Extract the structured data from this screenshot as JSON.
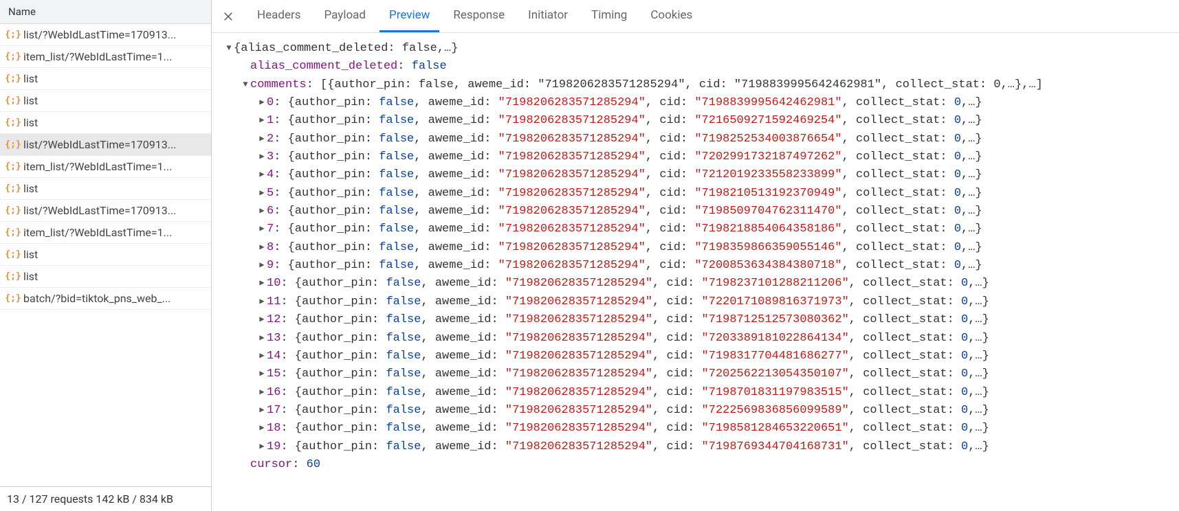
{
  "sidebar": {
    "header": "Name",
    "items": [
      {
        "label": "list/?WebIdLastTime=170913...",
        "selected": false
      },
      {
        "label": "item_list/?WebIdLastTime=1...",
        "selected": false
      },
      {
        "label": "list",
        "selected": false
      },
      {
        "label": "list",
        "selected": false
      },
      {
        "label": "list",
        "selected": false
      },
      {
        "label": "list/?WebIdLastTime=170913...",
        "selected": true
      },
      {
        "label": "item_list/?WebIdLastTime=1...",
        "selected": false
      },
      {
        "label": "list",
        "selected": false
      },
      {
        "label": "list/?WebIdLastTime=170913...",
        "selected": false
      },
      {
        "label": "item_list/?WebIdLastTime=1...",
        "selected": false
      },
      {
        "label": "list",
        "selected": false
      },
      {
        "label": "list",
        "selected": false
      },
      {
        "label": "batch/?bid=tiktok_pns_web_...",
        "selected": false
      }
    ],
    "footer": "13 / 127 requests   142 kB / 834 kB"
  },
  "tabs": [
    "Headers",
    "Payload",
    "Preview",
    "Response",
    "Initiator",
    "Timing",
    "Cookies"
  ],
  "activeTab": "Preview",
  "preview": {
    "rootSummary": "{alias_comment_deleted: false,…}",
    "alias_comment_deleted_key": "alias_comment_deleted",
    "alias_comment_deleted_val": "false",
    "comments_key": "comments",
    "comments_summary": "[{author_pin: false, aweme_id: \"7198206283571285294\", cid: \"7198839995642462981\", collect_stat: 0,…},…]",
    "cursor_key": "cursor",
    "cursor_val": "60",
    "items": [
      {
        "idx": 0,
        "aweme_id": "7198206283571285294",
        "cid": "7198839995642462981"
      },
      {
        "idx": 1,
        "aweme_id": "7198206283571285294",
        "cid": "7216509271592469254"
      },
      {
        "idx": 2,
        "aweme_id": "7198206283571285294",
        "cid": "7198252534003876654"
      },
      {
        "idx": 3,
        "aweme_id": "7198206283571285294",
        "cid": "7202991732187497262"
      },
      {
        "idx": 4,
        "aweme_id": "7198206283571285294",
        "cid": "7212019233558233899"
      },
      {
        "idx": 5,
        "aweme_id": "7198206283571285294",
        "cid": "7198210513192370949"
      },
      {
        "idx": 6,
        "aweme_id": "7198206283571285294",
        "cid": "7198509704762311470"
      },
      {
        "idx": 7,
        "aweme_id": "7198206283571285294",
        "cid": "7198218854064358186"
      },
      {
        "idx": 8,
        "aweme_id": "7198206283571285294",
        "cid": "7198359866359055146"
      },
      {
        "idx": 9,
        "aweme_id": "7198206283571285294",
        "cid": "7200853634384380718"
      },
      {
        "idx": 10,
        "aweme_id": "7198206283571285294",
        "cid": "7198237101288211206"
      },
      {
        "idx": 11,
        "aweme_id": "7198206283571285294",
        "cid": "7220171089816371973"
      },
      {
        "idx": 12,
        "aweme_id": "7198206283571285294",
        "cid": "7198712512573080362"
      },
      {
        "idx": 13,
        "aweme_id": "7198206283571285294",
        "cid": "7203389181022864134"
      },
      {
        "idx": 14,
        "aweme_id": "7198206283571285294",
        "cid": "7198317704481686277"
      },
      {
        "idx": 15,
        "aweme_id": "7198206283571285294",
        "cid": "7202562213054350107"
      },
      {
        "idx": 16,
        "aweme_id": "7198206283571285294",
        "cid": "7198701831197983515"
      },
      {
        "idx": 17,
        "aweme_id": "7198206283571285294",
        "cid": "7222569836856099589"
      },
      {
        "idx": 18,
        "aweme_id": "7198206283571285294",
        "cid": "7198581284653220651"
      },
      {
        "idx": 19,
        "aweme_id": "7198206283571285294",
        "cid": "7198769344704168731"
      }
    ]
  }
}
